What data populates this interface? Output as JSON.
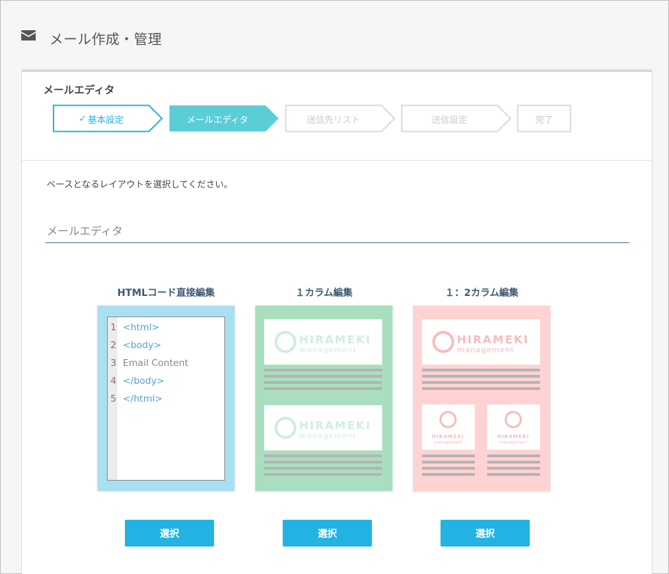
{
  "header": {
    "title": "メール作成・管理",
    "icon": "mail-icon"
  },
  "card": {
    "title": "メールエディタ",
    "steps": [
      {
        "label": "基本設定",
        "state": "done",
        "check": "✓"
      },
      {
        "label": "メールエディタ",
        "state": "active"
      },
      {
        "label": "送信先リスト",
        "state": "pending"
      },
      {
        "label": "送信設定",
        "state": "pending"
      },
      {
        "label": "完了",
        "state": "pending"
      }
    ],
    "instruction": "ベースとなるレイアウトを選択してください。",
    "section_title": "メールエディタ"
  },
  "layouts": [
    {
      "label": "HTMLコード直接編集",
      "color": "#aadff2",
      "code_lines": [
        {
          "num": "1",
          "text": "<html>",
          "kind": "tag"
        },
        {
          "num": "2",
          "text": "<body>",
          "kind": "tag"
        },
        {
          "num": "3",
          "text": "Email Content",
          "kind": "plain"
        },
        {
          "num": "4",
          "text": "</body>",
          "kind": "tag"
        },
        {
          "num": "5",
          "text": "</html>",
          "kind": "tag"
        }
      ],
      "button": "選択"
    },
    {
      "label": "１カラム編集",
      "color": "#a9dfbe",
      "logo_text": "HIRAMEKI",
      "logo_sub": "management",
      "button": "選択"
    },
    {
      "label": "１：2カラム編集",
      "color": "#ffd3d3",
      "logo_text": "HIRAMEKI",
      "logo_sub": "management",
      "button": "選択"
    }
  ],
  "colors": {
    "accent": "#22b3e3",
    "active_step": "#5bcdd7",
    "done_step_border": "#2ab0d5",
    "pending_step_border": "#d9d9d9"
  }
}
